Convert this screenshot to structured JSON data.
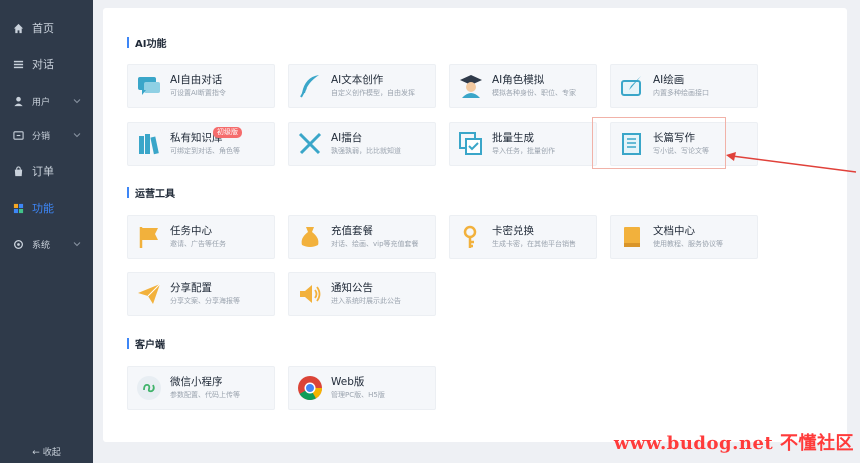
{
  "sidebar": {
    "items": [
      {
        "label": "首页",
        "icon": "home-icon"
      },
      {
        "label": "对话",
        "icon": "menu-icon"
      },
      {
        "label": "用户",
        "icon": "user-icon"
      },
      {
        "label": "分销",
        "icon": "share-icon"
      },
      {
        "label": "订单",
        "icon": "bag-icon"
      },
      {
        "label": "功能",
        "icon": "grid-icon"
      },
      {
        "label": "系统",
        "icon": "settings-icon"
      }
    ],
    "collapse_label": "← 收起"
  },
  "sections": {
    "ai": {
      "title": "AI功能",
      "tiles": [
        {
          "title": "AI自由对话",
          "desc": "可设置AI断置指令"
        },
        {
          "title": "AI文本创作",
          "desc": "自定义创作模型，自由发挥"
        },
        {
          "title": "AI角色模拟",
          "desc": "模拟各种身份、职位、专家"
        },
        {
          "title": "AI绘画",
          "desc": "内置多种绘画接口"
        },
        {
          "title": "私有知识库",
          "desc": "可绑定到对话、角色等",
          "badge": "初级版"
        },
        {
          "title": "AI擂台",
          "desc": "孰强孰弱，比比就知道"
        },
        {
          "title": "批量生成",
          "desc": "导入任务，批量创作"
        },
        {
          "title": "长篇写作",
          "desc": "写小说、写论文等"
        }
      ]
    },
    "ops": {
      "title": "运营工具",
      "tiles": [
        {
          "title": "任务中心",
          "desc": "邀请、广告等任务"
        },
        {
          "title": "充值套餐",
          "desc": "对话、绘画、vip等充值套餐"
        },
        {
          "title": "卡密兑换",
          "desc": "生成卡密，在其他平台销售"
        },
        {
          "title": "文档中心",
          "desc": "使用教程、服务协议等"
        },
        {
          "title": "分享配置",
          "desc": "分享文案、分享海报等"
        },
        {
          "title": "通知公告",
          "desc": "进入系统时展示此公告"
        }
      ]
    },
    "client": {
      "title": "客户端",
      "tiles": [
        {
          "title": "微信小程序",
          "desc": "参数配置、代码上传等"
        },
        {
          "title": "Web版",
          "desc": "管理PC版、H5版"
        }
      ]
    }
  },
  "watermark": "www.budog.net 不懂社区",
  "colors": {
    "accent": "#3d86f6",
    "sidebar": "#2f3a4a",
    "tile_icon": "#3aa6c9",
    "orange": "#f2b13c"
  }
}
